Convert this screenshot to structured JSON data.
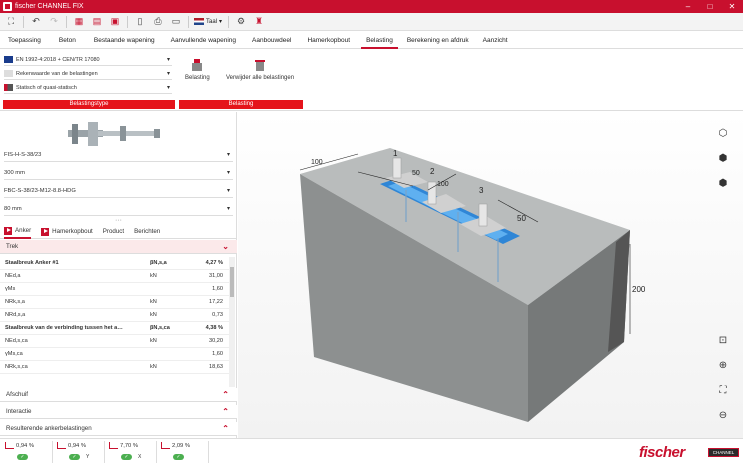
{
  "titlebar": {
    "title": "fischer CHANNEL FIX"
  },
  "toolbar": {
    "language": "Taal"
  },
  "tabs": [
    {
      "label": "Toepassing"
    },
    {
      "label": "Beton"
    },
    {
      "label": "Bestaande wapening"
    },
    {
      "label": "Aanvullende wapening"
    },
    {
      "label": "Aanbouwdeel"
    },
    {
      "label": "Hamerkopbout"
    },
    {
      "label": "Belasting"
    },
    {
      "label": "Berekening en afdruk"
    },
    {
      "label": "Aanzicht"
    }
  ],
  "ribbon": {
    "standard": "EN 1992-4:2018 + CEN/TR 17080",
    "load_values": "Rekenwaarde van de belastingen",
    "load_type": "Statisch of quasi-statisch",
    "btn_belasting": "Belasting",
    "btn_remove": "Verwijder alle belastingen",
    "group_loadtype": "Belastingstype",
    "group_load": "Belasting"
  },
  "left": {
    "channel": "FIS-H-S-38/23",
    "length": "300 mm",
    "bolt": "FBC-S-38/23-M12-8.8-HDG",
    "embed": "80 mm",
    "subtabs": {
      "anchor": "Anker",
      "hammer": "Hamerkopbout",
      "product": "Product",
      "messages": "Berichten"
    },
    "trek": "Trek",
    "rows": [
      {
        "label": "Staalbreuk Anker #1",
        "unit": "βN,s,a",
        "value": "4,27 %",
        "bold": true
      },
      {
        "label": "NEd,a",
        "unit": "kN",
        "value": "31,00"
      },
      {
        "label": "γMs",
        "unit": "",
        "value": "1,60"
      },
      {
        "label": "NRk,s,a",
        "unit": "kN",
        "value": "17,22"
      },
      {
        "label": "NRd,s,a",
        "unit": "kN",
        "value": "0,73"
      },
      {
        "label": "Staalbreuk van de verbinding tussen het a…",
        "unit": "βN,s,ca",
        "value": "4,38 %",
        "bold": true
      },
      {
        "label": "NEd,s,ca",
        "unit": "kN",
        "value": "30,20"
      },
      {
        "label": "γMs,ca",
        "unit": "",
        "value": "1,60"
      },
      {
        "label": "NRk,s,ca",
        "unit": "kN",
        "value": "18,63"
      }
    ],
    "sections": {
      "afschuif": "Afschuif",
      "interactie": "Interactie",
      "resultant": "Resulterende ankerbelastingen"
    }
  },
  "status": [
    {
      "pct": "0,94 %",
      "axis": ""
    },
    {
      "pct": "0,94 %",
      "axis": "Y"
    },
    {
      "pct": "7,70 %",
      "axis": "X"
    },
    {
      "pct": "2,09 %",
      "axis": ""
    }
  ],
  "brand": {
    "name": "fischer",
    "badge": "CHANNEL"
  },
  "view": {
    "dims": {
      "d100a": "100",
      "d50a": "50",
      "d100b": "100",
      "d50b": "50",
      "d200": "200"
    },
    "markers": {
      "m1": "1",
      "m2": "2",
      "m3": "3"
    }
  },
  "colors": {
    "accent": "#c8102e",
    "ok": "#4caf50"
  }
}
